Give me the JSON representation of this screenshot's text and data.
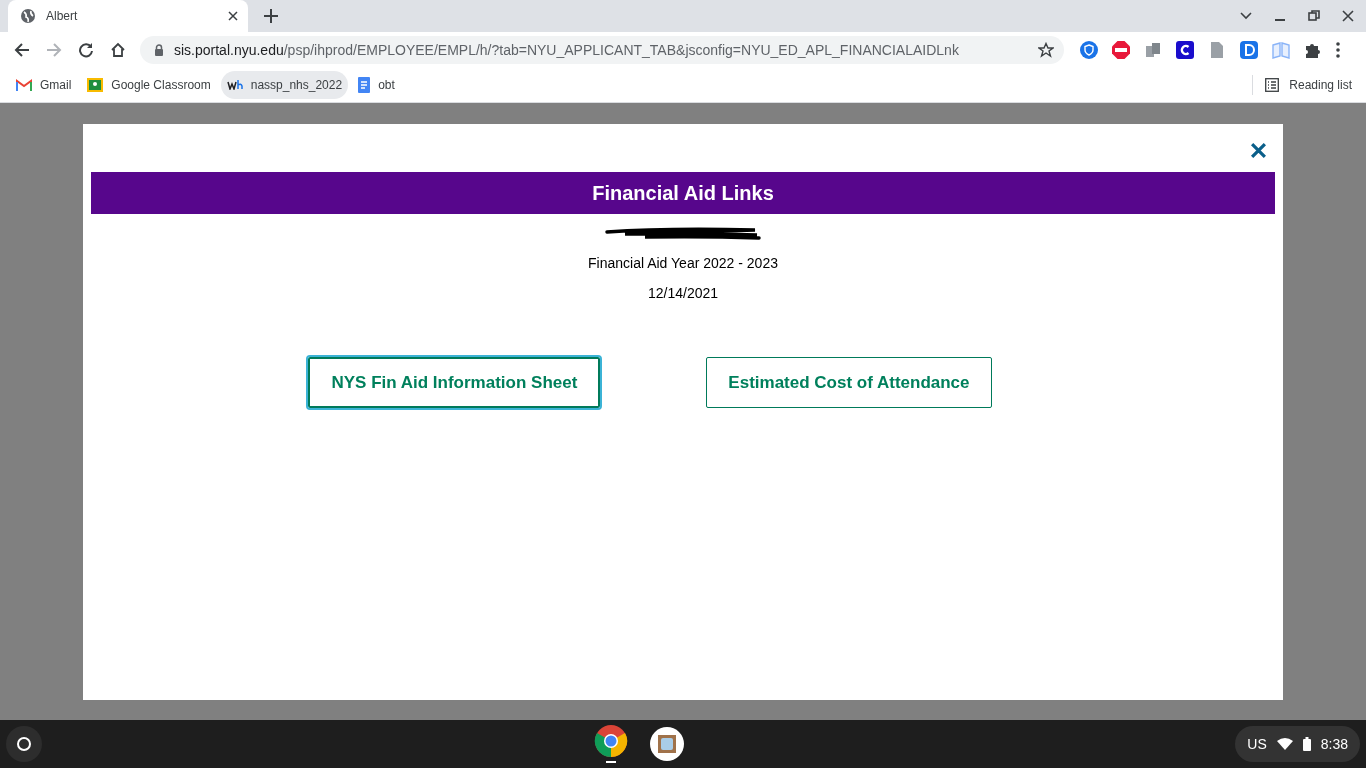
{
  "browser": {
    "tabs": [
      {
        "title": "Albert",
        "selected": true
      }
    ],
    "url": {
      "host": "sis.portal.nyu.edu",
      "path": "/psp/ihprod/EMPLOYEE/EMPL/h/?tab=NYU_APPLICANT_TAB&jsconfig=NYU_ED_APL_FINANCIALAIDLnk"
    },
    "bookmarks": [
      {
        "label": "Gmail",
        "kind": "gmail"
      },
      {
        "label": "Google Classroom",
        "kind": "classroom"
      },
      {
        "label": "nassp_nhs_2022",
        "kind": "wh"
      },
      {
        "label": "obt",
        "kind": "docs"
      }
    ],
    "reading_list": "Reading list"
  },
  "modal": {
    "title": "Financial Aid Links",
    "aid_year": "Financial Aid Year 2022 - 2023",
    "date": "12/14/2021",
    "buttons": [
      {
        "label": "NYS Fin Aid Information Sheet",
        "focused": true
      },
      {
        "label": "Estimated Cost of Attendance",
        "focused": false
      }
    ]
  },
  "shelf": {
    "locale": "US",
    "time": "8:38"
  }
}
